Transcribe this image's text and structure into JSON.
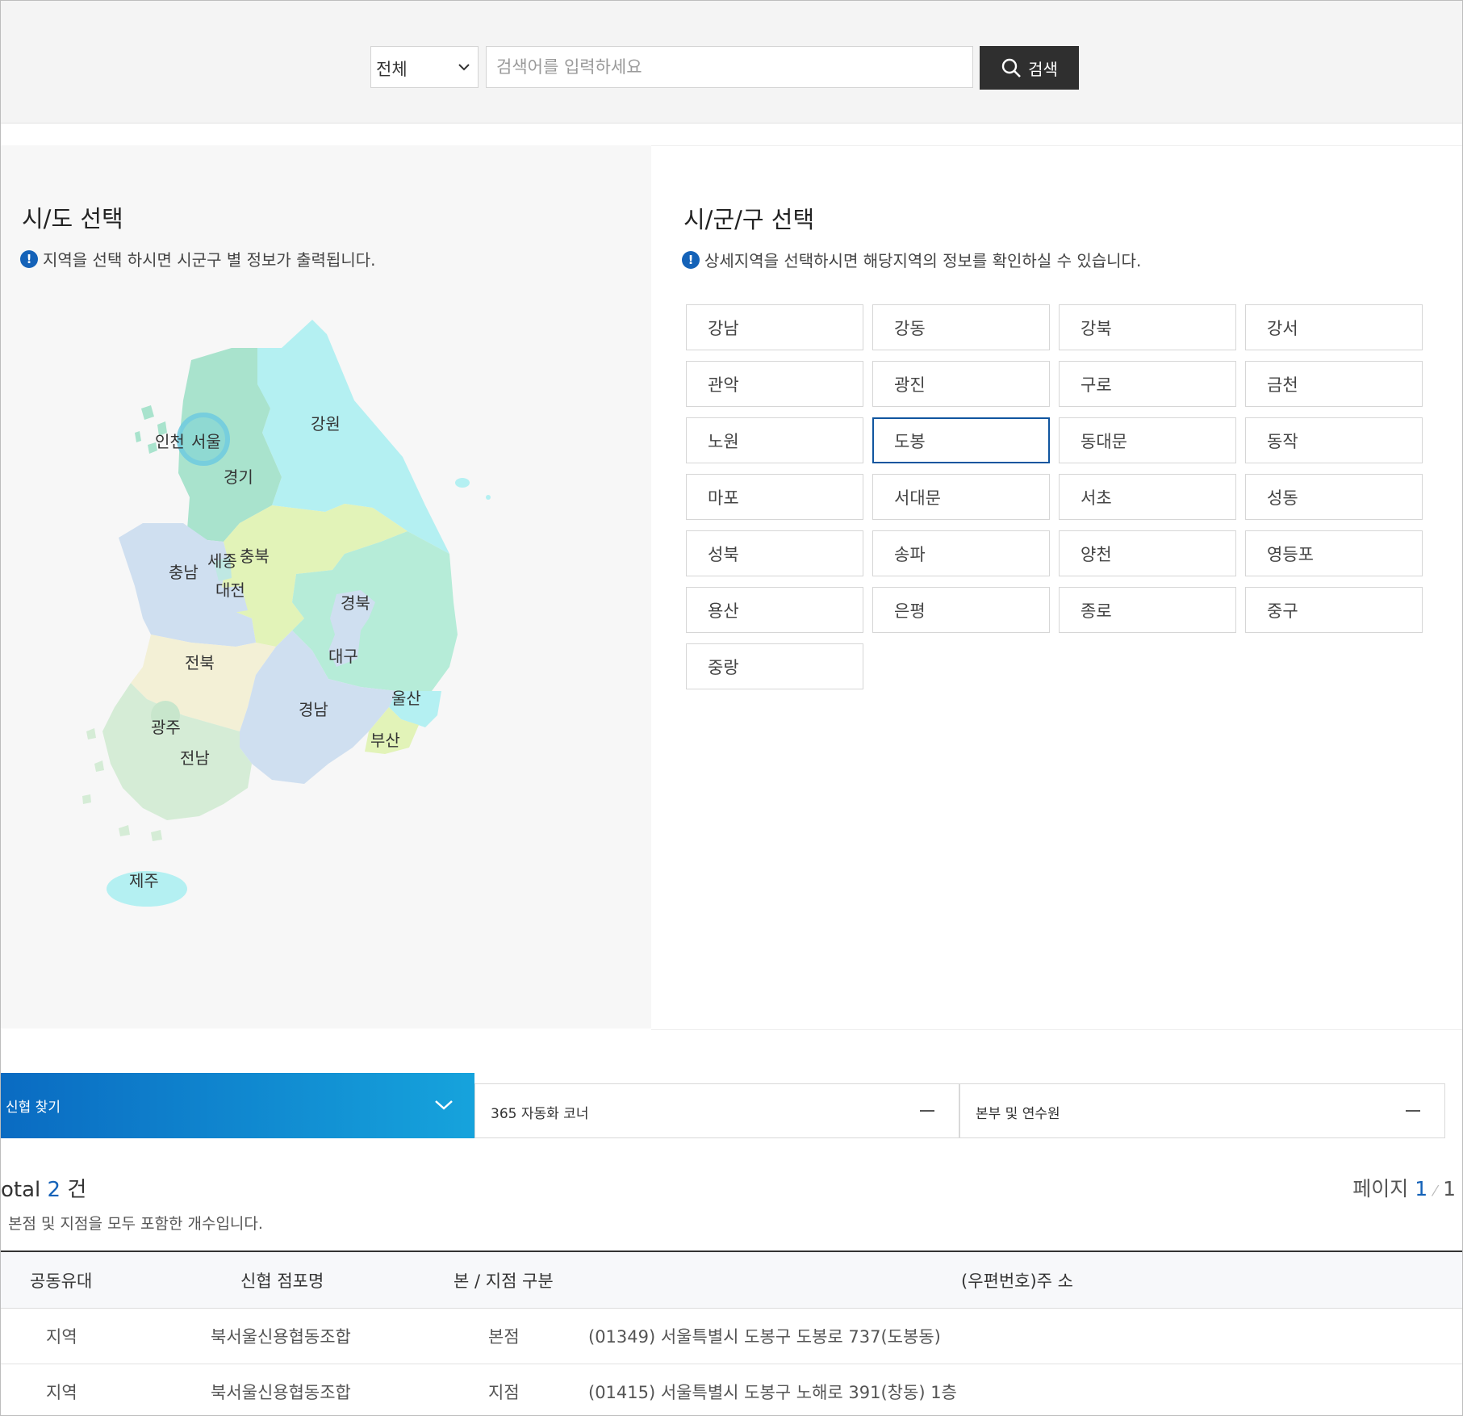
{
  "search": {
    "scope_value": "전체",
    "placeholder": "검색어를 입력하세요",
    "button_label": "검색"
  },
  "sido": {
    "title": "시/도 선택",
    "note": "지역을 선택 하시면 시군구 별 정보가 출력됩니다.",
    "regions": [
      "인천",
      "서울",
      "경기",
      "강원",
      "충남",
      "세종",
      "충북",
      "대전",
      "경북",
      "대구",
      "전북",
      "울산",
      "경남",
      "부산",
      "광주",
      "전남",
      "제주"
    ]
  },
  "sigungu": {
    "title": "시/군/구 선택",
    "note": "상세지역을 선택하시면 해당지역의 정보를 확인하실 수 있습니다.",
    "selected": "도봉",
    "districts": [
      "강남",
      "강동",
      "강북",
      "강서",
      "관악",
      "광진",
      "구로",
      "금천",
      "노원",
      "도봉",
      "동대문",
      "동작",
      "마포",
      "서대문",
      "서초",
      "성동",
      "성북",
      "송파",
      "양천",
      "영등포",
      "용산",
      "은평",
      "종로",
      "중구",
      "중랑"
    ]
  },
  "tabs": [
    {
      "label": "신협 찾기",
      "state": "expanded"
    },
    {
      "label": "365 자동화 코너",
      "state": "collapsed"
    },
    {
      "label": "본부 및 연수원",
      "state": "collapsed"
    }
  ],
  "results": {
    "total_prefix": "otal",
    "total_count": "2",
    "total_unit": "건",
    "note": "본점 및 지점을 모두 포함한 개수입니다.",
    "page_label": "페이지",
    "page_current": "1",
    "page_total": "1",
    "headers": [
      "공동유대",
      "신협 점포명",
      "본 / 지점 구분",
      "(우편번호)주 소"
    ],
    "rows": [
      {
        "type": "지역",
        "name": "북서울신용협동조합",
        "kind": "본점",
        "address": "(01349) 서울특별시 도봉구 도봉로 737(도봉동)"
      },
      {
        "type": "지역",
        "name": "북서울신용협동조합",
        "kind": "지점",
        "address": "(01415) 서울특별시 도봉구 노해로 391(창동) 1층"
      }
    ]
  },
  "colors": {
    "accent": "#1462b8",
    "search_button": "#2f2f2f",
    "tab_gradient_start": "#0a6bc2",
    "tab_gradient_end": "#16a3dc"
  }
}
